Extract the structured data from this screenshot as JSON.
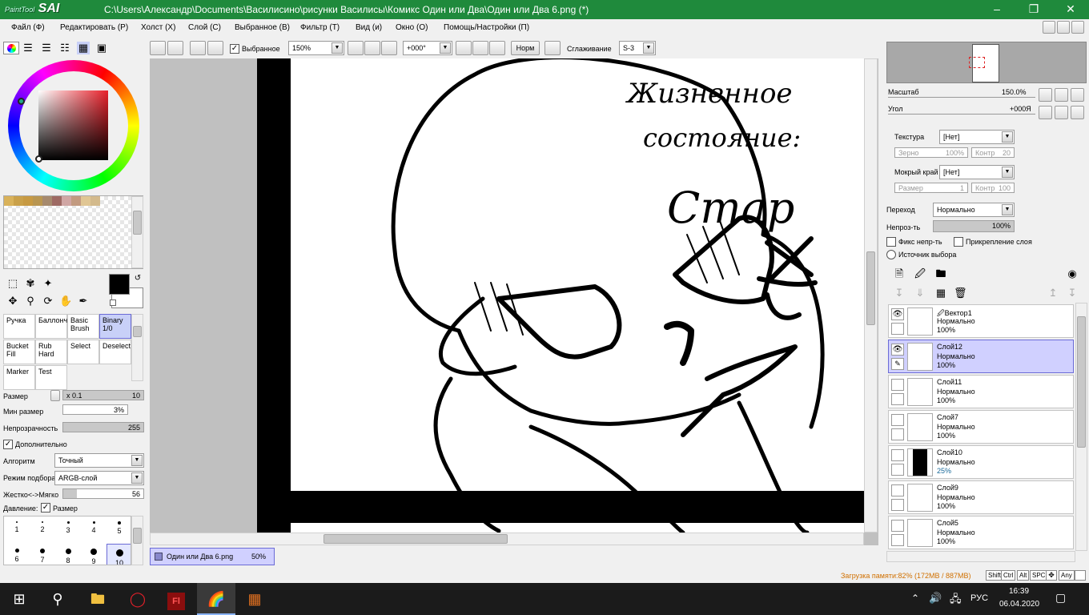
{
  "window": {
    "app_name": "PaintTool",
    "app_brand": "SAI",
    "path": "C:\\Users\\Александр\\Documents\\Василисино\\рисунки Василисы\\Комикс Один или Два\\Один или Два 6.png (*)"
  },
  "menu": [
    {
      "label": "Файл (Ф)"
    },
    {
      "label": "Редактировать (Р)"
    },
    {
      "label": "Холст (X)"
    },
    {
      "label": "Слой (С)"
    },
    {
      "label": "Выбранное (В)"
    },
    {
      "label": "Фильтр (Т)"
    },
    {
      "label": "Вид (и)"
    },
    {
      "label": "Окно (О)"
    },
    {
      "label": "Помощь/Настройки (П)"
    }
  ],
  "toolbar": {
    "selection_label": "Выбранное",
    "zoom": "150%",
    "angle": "+000°",
    "norm_label": "Норм",
    "smoothing_label": "Сглаживание",
    "smoothing_value": "S-3"
  },
  "colors": {
    "primary": "#000000",
    "secondary": "#ffffff",
    "titlebar": "#1f8a3c"
  },
  "tools": {
    "brushes": [
      {
        "label": "Ручка",
        "value": ""
      },
      {
        "label": "Баллонч",
        "value": ""
      },
      {
        "label": "Basic Brush",
        "value": ""
      },
      {
        "label": "Binary",
        "value": "1/0"
      },
      {
        "label": "Bucket Fill",
        "value": ""
      },
      {
        "label": "Rub Hard",
        "value": ""
      },
      {
        "label": "Select",
        "value": ""
      },
      {
        "label": "Deselect",
        "value": ""
      },
      {
        "label": "Marker",
        "value": ""
      },
      {
        "label": "Test",
        "value": ""
      }
    ]
  },
  "brush_settings": {
    "size_label": "Размер",
    "size_mult": "x 0.1",
    "size_value": "10",
    "min_size_label": "Мин размер",
    "min_size_value": "3%",
    "opacity_label": "Непрозрачность",
    "opacity_value": "255",
    "opacity_fraction": 1.0,
    "advanced_label": "Дополнительно",
    "algorithm_label": "Алгоритм",
    "algorithm_value": "Точный",
    "pick_mode_label": "Режим подбора",
    "pick_mode_value": "ARGB-слой",
    "hardness_label": "Жестко<->Мягко",
    "hardness_value": "56",
    "hardness_fraction": 0.56,
    "pressure_label": "Давление:",
    "pressure_size_label": "Размер",
    "brush_sizes": [
      "1",
      "2",
      "3",
      "4",
      "5",
      "6",
      "7",
      "8",
      "9",
      "10"
    ]
  },
  "document_tab": {
    "name": "Один или Два 6.png",
    "zoom": "50%"
  },
  "canvas_text": {
    "line1": "Жизненное",
    "line2": "состояние:",
    "line3": "Стар"
  },
  "navigator": {
    "scale_label": "Масштаб",
    "scale_value": "150.0%",
    "angle_label": "Угол",
    "angle_value": "+000Я"
  },
  "layer_props": {
    "texture_label": "Текстура",
    "texture_value": "[Нет]",
    "grain_label": "Зерно",
    "grain_value": "100%",
    "contrast_label": "Контр",
    "contrast_value": "20",
    "wet_edge_label": "Мокрый край",
    "wet_edge_value": "[Нет]",
    "size_label": "Размер",
    "size_value": "1",
    "contrast2_label": "Контр",
    "contrast2_value": "100",
    "blend_label": "Переход",
    "blend_value": "Нормально",
    "opacity_label": "Непроз-ть",
    "opacity_value": "100%",
    "opacity_fraction": 1.0,
    "fix_opacity_label": "Фикс непр-ть",
    "clip_layer_label": "Прикрепление слоя",
    "selection_source_label": "Источник выбора"
  },
  "layers": [
    {
      "name": "Вектор1",
      "mode": "Нормально",
      "opacity": "100%"
    },
    {
      "name": "Слой12",
      "mode": "Нормально",
      "opacity": "100%"
    },
    {
      "name": "Слой11",
      "mode": "Нормально",
      "opacity": "100%"
    },
    {
      "name": "Слой7",
      "mode": "Нормально",
      "opacity": "100%"
    },
    {
      "name": "Слой10",
      "mode": "Нормально",
      "opacity": "25%"
    },
    {
      "name": "Слой9",
      "mode": "Нормально",
      "opacity": "100%"
    },
    {
      "name": "Слой5",
      "mode": "Нормально",
      "opacity": "100%"
    }
  ],
  "status": {
    "memory": "Загрузка памяти:82% (172MB / 887MB)",
    "keys": [
      "Shift",
      "Ctrl",
      "Alt",
      "SPC",
      "Any"
    ]
  },
  "taskbar": {
    "language": "РУС",
    "time": "16:39",
    "date": "06.04.2020"
  }
}
